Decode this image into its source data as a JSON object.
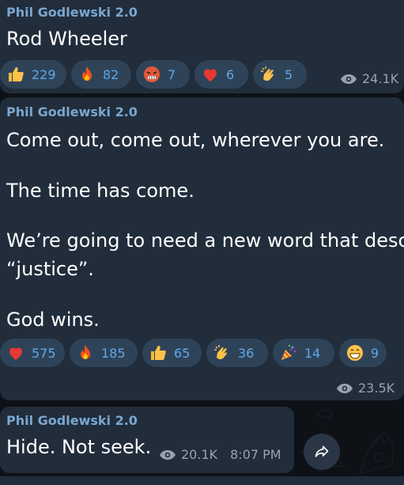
{
  "messages": [
    {
      "sender": "Phil Godlewski 2.0",
      "text": "Rod Wheeler",
      "reactions": [
        {
          "icon": "thumbs-up-icon",
          "count": "229"
        },
        {
          "icon": "fire-icon",
          "count": "82"
        },
        {
          "icon": "angry-face-icon",
          "count": "7"
        },
        {
          "icon": "red-heart-icon",
          "count": "6"
        },
        {
          "icon": "clapping-hands-icon",
          "count": "5"
        }
      ],
      "views": "24.1K"
    },
    {
      "sender": "Phil Godlewski 2.0",
      "lines": [
        "Come out, come out, wherever you are.",
        "The time has come.",
        "We’re going to need a new word that desc",
        "“justice”.",
        "God wins."
      ],
      "reactions": [
        {
          "icon": "red-heart-icon",
          "count": "575"
        },
        {
          "icon": "fire-icon",
          "count": "185"
        },
        {
          "icon": "thumbs-up-icon",
          "count": "65"
        },
        {
          "icon": "clapping-hands-icon",
          "count": "36"
        },
        {
          "icon": "party-popper-icon",
          "count": "14"
        },
        {
          "icon": "grinning-face-icon",
          "count": "9"
        }
      ],
      "views": "23.5K"
    },
    {
      "sender": "Phil Godlewski 2.0",
      "text": "Hide. Not seek.",
      "views": "20.1K",
      "time": "8:07 PM"
    }
  ],
  "colors": {
    "background": "#0e1116",
    "bubble": "#212d3b",
    "sender": "#7aa7d0",
    "reaction_pill": "#2f4358",
    "reaction_count": "#5fa8e8",
    "meta": "#9aa3ad"
  }
}
